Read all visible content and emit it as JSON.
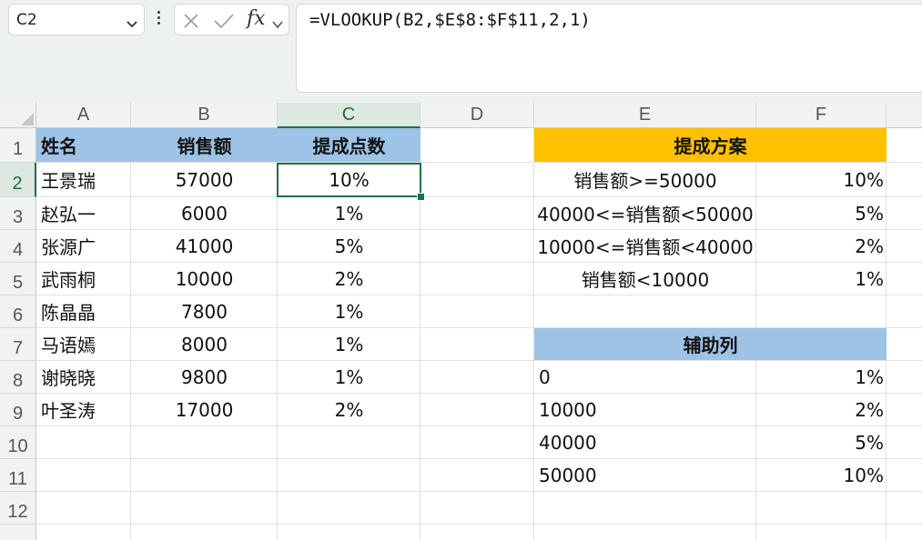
{
  "formula_bar": {
    "name_box": "C2",
    "formula": "=VLOOKUP(B2,$E$8:$F$11,2,1)",
    "icons": [
      "chevron-down-icon",
      "more-vertical-icon",
      "cancel-icon",
      "check-icon",
      "function-icon",
      "chevron-down-icon"
    ],
    "fx_label": "fx"
  },
  "sheet": {
    "columns": [
      "A",
      "B",
      "C",
      "D",
      "E",
      "F"
    ],
    "rows": [
      "1",
      "2",
      "3",
      "4",
      "5",
      "6",
      "7",
      "8",
      "9",
      "10",
      "11",
      "12"
    ],
    "selected_cell": "C2",
    "header_fill": "#9dc3e6",
    "plan_fill": "#ffc000",
    "main_table": {
      "headers": [
        "姓名",
        "销售额",
        "提成点数"
      ],
      "rows": [
        [
          "王景瑞",
          "57000",
          "10%"
        ],
        [
          "赵弘一",
          "6000",
          "1%"
        ],
        [
          "张源广",
          "41000",
          "5%"
        ],
        [
          "武雨桐",
          "10000",
          "2%"
        ],
        [
          "陈晶晶",
          "7800",
          "1%"
        ],
        [
          "马语嫣",
          "8000",
          "1%"
        ],
        [
          "谢晓晓",
          "9800",
          "1%"
        ],
        [
          "叶圣涛",
          "17000",
          "2%"
        ]
      ]
    },
    "plan_table": {
      "title": "提成方案",
      "rows": [
        [
          "销售额>=50000",
          "10%"
        ],
        [
          "40000<=销售额<50000",
          "5%"
        ],
        [
          "10000<=销售额<40000",
          "2%"
        ],
        [
          "销售额<10000",
          "1%"
        ]
      ]
    },
    "helper_table": {
      "title": "辅助列",
      "rows": [
        [
          "0",
          "1%"
        ],
        [
          "10000",
          "2%"
        ],
        [
          "40000",
          "5%"
        ],
        [
          "50000",
          "10%"
        ]
      ]
    }
  }
}
